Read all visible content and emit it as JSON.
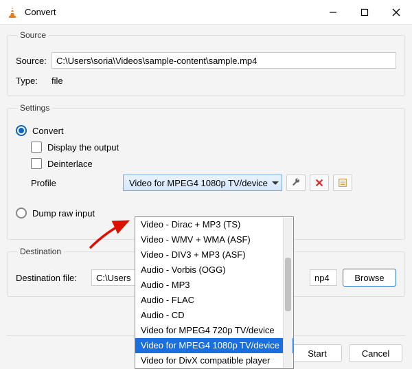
{
  "window": {
    "title": "Convert"
  },
  "source": {
    "legend": "Source",
    "source_label": "Source:",
    "source_value": "C:\\Users\\soria\\Videos\\sample-content\\sample.mp4",
    "type_label": "Type:",
    "type_value": "file"
  },
  "settings": {
    "legend": "Settings",
    "convert_label": "Convert",
    "display_output_label": "Display the output",
    "deinterlace_label": "Deinterlace",
    "profile_label": "Profile",
    "profile_selected": "Video for MPEG4 1080p TV/device",
    "dump_label": "Dump raw input",
    "dropdown_items": [
      "Video - Dirac + MP3 (TS)",
      "Video - WMV + WMA (ASF)",
      "Video - DIV3 + MP3 (ASF)",
      "Audio - Vorbis (OGG)",
      "Audio - MP3",
      "Audio - FLAC",
      "Audio - CD",
      "Video for MPEG4 720p TV/device",
      "Video for MPEG4 1080p TV/device",
      "Video for DivX compatible player"
    ],
    "dropdown_selected_index": 8
  },
  "destination": {
    "legend": "Destination",
    "label": "Destination file:",
    "value_left": "C:\\Users",
    "value_right": "np4",
    "browse_label": "Browse"
  },
  "footer": {
    "start_label": "Start",
    "cancel_label": "Cancel"
  }
}
